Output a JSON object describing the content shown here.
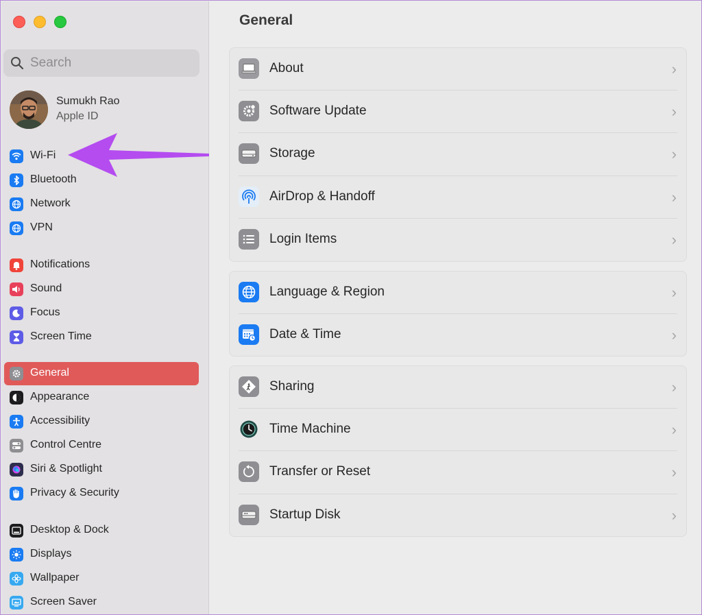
{
  "search": {
    "placeholder": "Search"
  },
  "profile": {
    "name": "Sumukh Rao",
    "subtitle": "Apple ID"
  },
  "sidebar": {
    "items": [
      {
        "label": "Wi-Fi",
        "icon": "wifi-icon",
        "color": "#1a7bf2"
      },
      {
        "label": "Bluetooth",
        "icon": "bluetooth-icon",
        "color": "#1a7bf2"
      },
      {
        "label": "Network",
        "icon": "globe-icon",
        "color": "#1a7bf2"
      },
      {
        "label": "VPN",
        "icon": "vpn-globe-icon",
        "color": "#1a7bf2"
      },
      {
        "label": "Notifications",
        "icon": "bell-icon",
        "color": "#f0443a"
      },
      {
        "label": "Sound",
        "icon": "speaker-icon",
        "color": "#e8405a"
      },
      {
        "label": "Focus",
        "icon": "moon-icon",
        "color": "#5e5ce6"
      },
      {
        "label": "Screen Time",
        "icon": "hourglass-icon",
        "color": "#5e5ce6"
      },
      {
        "label": "General",
        "icon": "gear-icon",
        "color": "#8e8e93",
        "active": true
      },
      {
        "label": "Appearance",
        "icon": "appearance-icon",
        "color": "#1c1c1e"
      },
      {
        "label": "Accessibility",
        "icon": "accessibility-icon",
        "color": "#1a7bf2"
      },
      {
        "label": "Control Centre",
        "icon": "toggles-icon",
        "color": "#8e8e93"
      },
      {
        "label": "Siri & Spotlight",
        "icon": "siri-icon",
        "color": "#2d2d4d"
      },
      {
        "label": "Privacy & Security",
        "icon": "hand-icon",
        "color": "#1a7bf2"
      },
      {
        "label": "Desktop & Dock",
        "icon": "dock-icon",
        "color": "#1c1c1e"
      },
      {
        "label": "Displays",
        "icon": "sun-icon",
        "color": "#1a7bf2"
      },
      {
        "label": "Wallpaper",
        "icon": "flower-icon",
        "color": "#37a9f0"
      },
      {
        "label": "Screen Saver",
        "icon": "screensaver-icon",
        "color": "#37a9f0"
      }
    ]
  },
  "main": {
    "title": "General",
    "groups": [
      {
        "rows": [
          {
            "label": "About",
            "icon": "laptop-icon"
          },
          {
            "label": "Software Update",
            "icon": "gear-badge-icon"
          },
          {
            "label": "Storage",
            "icon": "drive-icon"
          },
          {
            "label": "AirDrop & Handoff",
            "icon": "airdrop-icon"
          },
          {
            "label": "Login Items",
            "icon": "list-icon"
          }
        ]
      },
      {
        "rows": [
          {
            "label": "Language & Region",
            "icon": "globe-icon"
          },
          {
            "label": "Date & Time",
            "icon": "calendar-clock-icon"
          }
        ]
      },
      {
        "rows": [
          {
            "label": "Sharing",
            "icon": "sharing-icon"
          },
          {
            "label": "Time Machine",
            "icon": "time-machine-icon"
          },
          {
            "label": "Transfer or Reset",
            "icon": "reset-icon"
          },
          {
            "label": "Startup Disk",
            "icon": "disk-icon"
          }
        ]
      }
    ]
  },
  "annotation": {
    "icon": "pointer-arrow-icon",
    "color": "#b44cf0"
  },
  "chevron": "›"
}
